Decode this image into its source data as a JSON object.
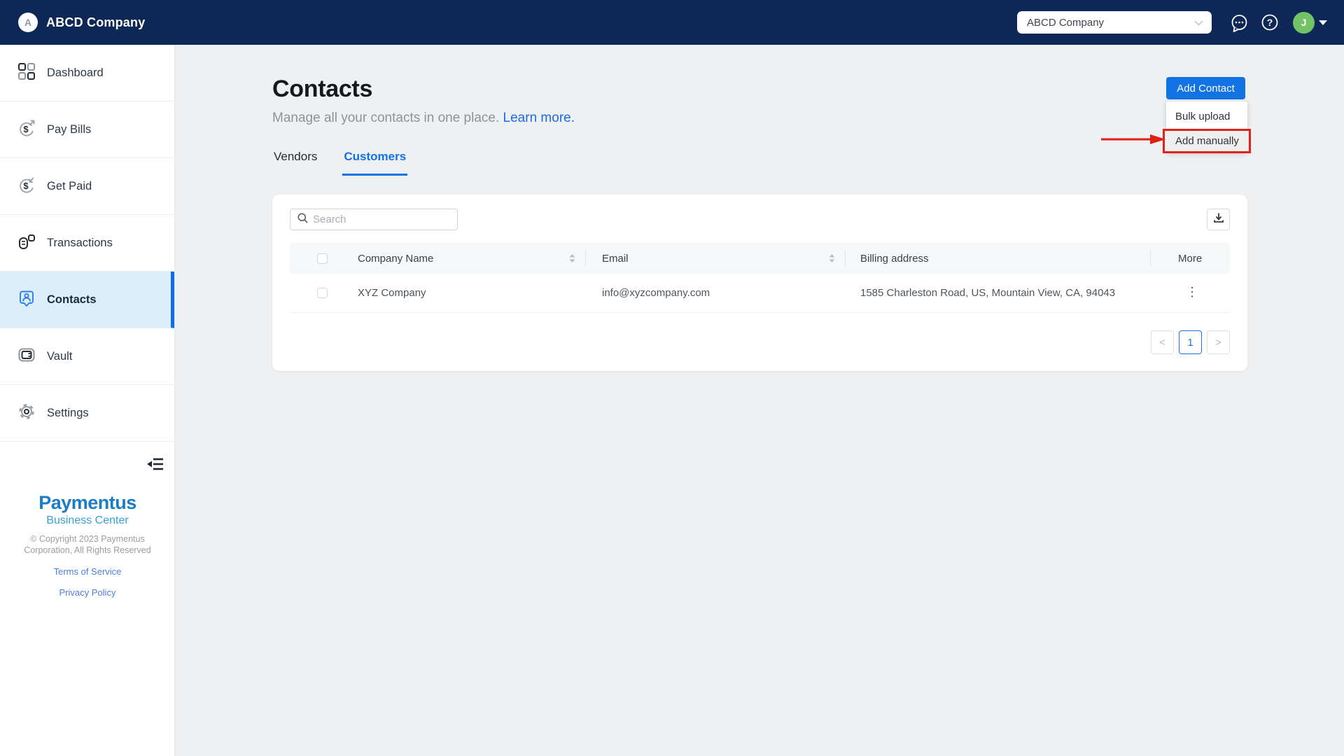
{
  "topbar": {
    "logo_initial": "A",
    "brand": "ABCD Company",
    "company_select": "ABCD Company",
    "avatar_initial": "J"
  },
  "sidebar": {
    "items": [
      {
        "label": "Dashboard"
      },
      {
        "label": "Pay Bills"
      },
      {
        "label": "Get Paid"
      },
      {
        "label": "Transactions"
      },
      {
        "label": "Contacts"
      },
      {
        "label": "Vault"
      },
      {
        "label": "Settings"
      }
    ],
    "footer": {
      "brand": "Paymentus",
      "brand_sub": "Business Center",
      "copyright1": "© Copyright 2023 Paymentus",
      "copyright2": "Corporation, All Rights Reserved",
      "terms": "Terms of Service",
      "privacy": "Privacy Policy"
    }
  },
  "page": {
    "title": "Contacts",
    "subtitle": "Manage all your contacts in one place.",
    "learn_more": "Learn more.",
    "tabs": {
      "vendors": "Vendors",
      "customers": "Customers"
    },
    "add_contact": "Add Contact",
    "menu": {
      "bulk_upload": "Bulk upload",
      "add_manually": "Add manually"
    }
  },
  "card": {
    "search_placeholder": "Search",
    "columns": {
      "company": "Company Name",
      "email": "Email",
      "billing": "Billing address",
      "more": "More"
    },
    "row": {
      "company": "XYZ Company",
      "email": "info@xyzcompany.com",
      "billing": "1585 Charleston Road, US, Mountain View, CA, 94043"
    },
    "pagination": {
      "prev": "<",
      "page": "1",
      "next": ">"
    }
  },
  "colors": {
    "navbar": "#0d2757",
    "accent_blue": "#1372e4",
    "active_item_bg": "#ddeefb",
    "annotation_red": "#e0231b",
    "brand_blue": "#1b7ec2",
    "brand_light_blue": "#35a0d6",
    "avatar_green": "#72c267"
  }
}
